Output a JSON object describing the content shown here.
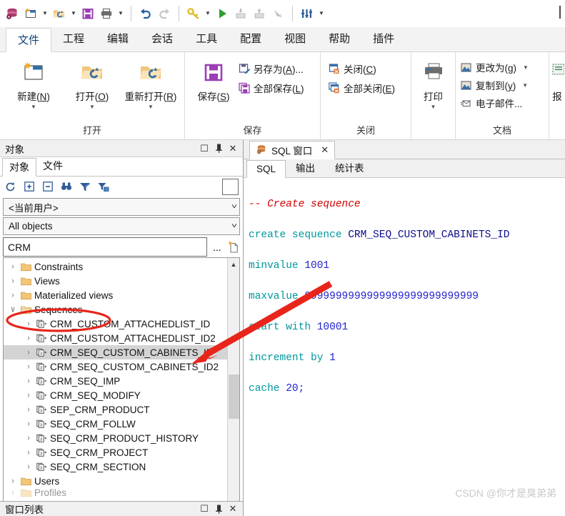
{
  "app": {
    "quick_access": [
      {
        "name": "database-icon",
        "label": "数据库"
      },
      {
        "name": "new-window-icon",
        "label": "新建窗口"
      },
      {
        "name": "open-icon",
        "label": "打开"
      },
      {
        "name": "save-icon",
        "label": "保存"
      },
      {
        "name": "print-icon",
        "label": "打印"
      },
      {
        "name": "undo-icon",
        "label": "撤销"
      },
      {
        "name": "redo-icon",
        "label": "重做"
      },
      {
        "name": "key-icon",
        "label": "登录"
      },
      {
        "name": "execute-icon",
        "label": "执行"
      },
      {
        "name": "import-icon",
        "label": "导入"
      },
      {
        "name": "export-icon",
        "label": "导出"
      },
      {
        "name": "break-icon",
        "label": "中断"
      },
      {
        "name": "preferences-icon",
        "label": "首选项"
      }
    ]
  },
  "menubar": {
    "tabs": [
      {
        "label": "文件",
        "active": true
      },
      {
        "label": "工程",
        "active": false
      },
      {
        "label": "编辑",
        "active": false
      },
      {
        "label": "会话",
        "active": false
      },
      {
        "label": "工具",
        "active": false
      },
      {
        "label": "配置",
        "active": false
      },
      {
        "label": "视图",
        "active": false
      },
      {
        "label": "帮助",
        "active": false
      },
      {
        "label": "插件",
        "active": false
      }
    ]
  },
  "ribbon": {
    "groups": [
      {
        "title": "打开",
        "big_buttons": [
          {
            "label_pre": "新建(",
            "accel": "N",
            "label_post": ")",
            "icon": "new-document-icon",
            "has_dropdown": true
          },
          {
            "label_pre": "打开(",
            "accel": "O",
            "label_post": ")",
            "icon": "open-folder-icon",
            "has_dropdown": true
          },
          {
            "label_pre": "重新打开(",
            "accel": "R",
            "label_post": ")",
            "icon": "reopen-folder-icon",
            "has_dropdown": true
          }
        ]
      },
      {
        "title": "保存",
        "big_buttons": [
          {
            "label_pre": "保存(",
            "accel": "S",
            "label_post": ")",
            "icon": "floppy-disk-icon",
            "has_dropdown": false
          }
        ],
        "small_buttons": [
          {
            "label_pre": "另存为(",
            "accel": "A",
            "label_post": ")...",
            "icon": "save-as-icon",
            "has_caret": false
          },
          {
            "label_pre": "全部保存(",
            "accel": "L",
            "label_post": ")",
            "icon": "save-all-icon",
            "has_caret": false
          }
        ]
      },
      {
        "title": "关闭",
        "small_buttons": [
          {
            "label_pre": "关闭(",
            "accel": "C",
            "label_post": ")",
            "icon": "close-window-icon",
            "has_caret": false
          },
          {
            "label_pre": "全部关闭(",
            "accel": "E",
            "label_post": ")",
            "icon": "close-all-windows-icon",
            "has_caret": false
          }
        ]
      },
      {
        "title": "",
        "big_buttons": [
          {
            "label_pre": "打印",
            "accel": "",
            "label_post": "",
            "icon": "printer-icon",
            "has_dropdown": true
          }
        ]
      },
      {
        "title": "文档",
        "small_buttons": [
          {
            "label_pre": "更改为(",
            "accel": "g",
            "label_post": ")",
            "icon": "change-to-icon",
            "has_caret": true
          },
          {
            "label_pre": "复制到(",
            "accel": "y",
            "label_post": ")",
            "icon": "copy-to-icon",
            "has_caret": true
          },
          {
            "label_pre": "电子邮件...",
            "accel": "",
            "label_post": "",
            "icon": "email-icon",
            "has_caret": false
          }
        ]
      },
      {
        "title": "",
        "big_buttons": [
          {
            "label_pre": "报",
            "accel": "",
            "label_post": "",
            "icon": "report-icon",
            "has_dropdown": false
          }
        ]
      }
    ]
  },
  "object_panel": {
    "caption": "对象",
    "caption_buttons": [
      {
        "name": "maximize-icon",
        "glyph": "☐"
      },
      {
        "name": "pin-icon",
        "glyph": "⎯"
      },
      {
        "name": "close-icon",
        "glyph": "✕"
      }
    ],
    "tabs": [
      {
        "label": "对象",
        "active": true
      },
      {
        "label": "文件",
        "active": false
      }
    ],
    "toolbar": [
      {
        "name": "refresh-icon"
      },
      {
        "name": "expand-all-icon"
      },
      {
        "name": "collapse-all-icon"
      },
      {
        "name": "find-icon"
      },
      {
        "name": "filter-icon"
      },
      {
        "name": "filter-settings-icon"
      }
    ],
    "user_combo": "<当前用户>",
    "type_combo": "All objects",
    "filter_value": "CRM",
    "filter_more_label": "...",
    "tree": [
      {
        "label": "Constraints",
        "type": "folder",
        "level": 1,
        "twist": "›",
        "selected": false
      },
      {
        "label": "Views",
        "type": "folder",
        "level": 1,
        "twist": "›",
        "selected": false
      },
      {
        "label": "Materialized views",
        "type": "folder",
        "level": 1,
        "twist": "›",
        "selected": false
      },
      {
        "label": "Sequences",
        "type": "folder-open",
        "level": 1,
        "twist": "∨",
        "selected": false,
        "circled": true
      },
      {
        "label": "CRM_CUSTOM_ATTACHEDLIST_ID",
        "type": "sequence",
        "level": 2,
        "twist": "›",
        "selected": false
      },
      {
        "label": "CRM_CUSTOM_ATTACHEDLIST_ID2",
        "type": "sequence",
        "level": 2,
        "twist": "›",
        "selected": false
      },
      {
        "label": "CRM_SEQ_CUSTOM_CABINETS_ID",
        "type": "sequence",
        "level": 2,
        "twist": "›",
        "selected": true
      },
      {
        "label": "CRM_SEQ_CUSTOM_CABINETS_ID2",
        "type": "sequence",
        "level": 2,
        "twist": "›",
        "selected": false
      },
      {
        "label": "CRM_SEQ_IMP",
        "type": "sequence",
        "level": 2,
        "twist": "›",
        "selected": false
      },
      {
        "label": "CRM_SEQ_MODIFY",
        "type": "sequence",
        "level": 2,
        "twist": "›",
        "selected": false
      },
      {
        "label": "SEP_CRM_PRODUCT",
        "type": "sequence",
        "level": 2,
        "twist": "›",
        "selected": false
      },
      {
        "label": "SEQ_CRM_FOLLW",
        "type": "sequence",
        "level": 2,
        "twist": "›",
        "selected": false
      },
      {
        "label": "SEQ_CRM_PRODUCT_HISTORY",
        "type": "sequence",
        "level": 2,
        "twist": "›",
        "selected": false
      },
      {
        "label": "SEQ_CRM_PROJECT",
        "type": "sequence",
        "level": 2,
        "twist": "›",
        "selected": false
      },
      {
        "label": "SEQ_CRM_SECTION",
        "type": "sequence",
        "level": 2,
        "twist": "›",
        "selected": false
      },
      {
        "label": "Users",
        "type": "folder",
        "level": 1,
        "twist": "›",
        "selected": false
      }
    ]
  },
  "sql_window": {
    "doc_tab": {
      "label": "SQL 窗口",
      "icon": "database-icon",
      "close_glyph": "✕"
    },
    "sub_tabs": [
      {
        "label": "SQL",
        "active": true
      },
      {
        "label": "输出",
        "active": false
      },
      {
        "label": "统计表",
        "active": false
      }
    ],
    "code_lines": [
      [
        {
          "t": "-- Create sequence",
          "c": "c-comment"
        }
      ],
      [
        {
          "t": "create sequence ",
          "c": "c-kw"
        },
        {
          "t": "CRM_SEQ_CUSTOM_CABINETS_ID",
          "c": "c-id"
        }
      ],
      [
        {
          "t": "minvalue ",
          "c": "c-kw"
        },
        {
          "t": "1001",
          "c": "c-num"
        }
      ],
      [
        {
          "t": "maxvalue ",
          "c": "c-kw"
        },
        {
          "t": "9999999999999999999999999999",
          "c": "c-num"
        }
      ],
      [
        {
          "t": "start with ",
          "c": "c-kw"
        },
        {
          "t": "10001",
          "c": "c-num"
        }
      ],
      [
        {
          "t": "increment by ",
          "c": "c-kw"
        },
        {
          "t": "1",
          "c": "c-num"
        }
      ],
      [
        {
          "t": "cache ",
          "c": "c-kw"
        },
        {
          "t": "20;",
          "c": "c-num"
        }
      ]
    ]
  },
  "bottom_panel": {
    "caption": "窗口列表",
    "caption_buttons": [
      {
        "name": "maximize-icon",
        "glyph": "☐"
      },
      {
        "name": "pin-icon",
        "glyph": "⎯"
      },
      {
        "name": "close-icon",
        "glyph": "✕"
      }
    ]
  },
  "watermark": "CSDN @你才是臭弟弟",
  "colors": {
    "accent_red": "#e8251b",
    "tab_active_text": "#12447a",
    "selection_gray": "#d4d4d4",
    "folder_yellow": "#f3c677"
  }
}
